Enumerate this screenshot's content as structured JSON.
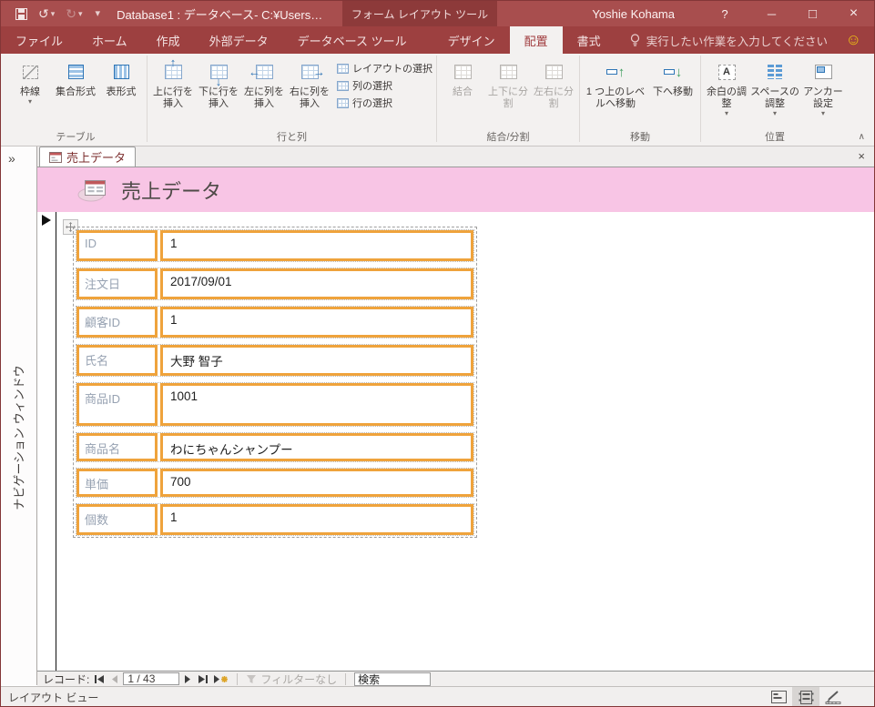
{
  "titlebar": {
    "app_title": "Database1 : データベース- C:¥Users…",
    "contextual_tool": "フォーム レイアウト ツール",
    "user_name": "Yoshie Kohama",
    "help_label": "?",
    "minimize_glyph": "─",
    "maximize_glyph": "□",
    "close_glyph": "×"
  },
  "qat": {
    "undo_glyph": "↺",
    "redo_glyph": "↻",
    "dropdown_glyph": "▾"
  },
  "ribbon_tabs": {
    "file": "ファイル",
    "home": "ホーム",
    "create": "作成",
    "external_data": "外部データ",
    "db_tools": "データベース ツール",
    "design": "デザイン",
    "arrange": "配置",
    "format": "書式",
    "tell_me": "実行したい作業を入力してください",
    "smiley_glyph": "☺"
  },
  "ribbon": {
    "collapse_glyph": "∧",
    "dropdown_glyph": "▾",
    "groups": {
      "table": "テーブル",
      "rows_columns": "行と列",
      "merge_split": "結合/分割",
      "move": "移動",
      "position": "位置"
    },
    "buttons": {
      "gridlines": "枠線",
      "stacked": "集合形式",
      "tabular": "表形式",
      "insert_above": "上に行を挿入",
      "insert_below": "下に行を挿入",
      "insert_left": "左に列を挿入",
      "insert_right": "右に列を挿入",
      "select_layout": "レイアウトの選択",
      "select_column": "列の選択",
      "select_row": "行の選択",
      "merge": "結合",
      "split_vertical": "上下に分割",
      "split_horizontal": "左右に分割",
      "move_up": "1 つ上のレベルへ移動",
      "move_down": "下へ移動",
      "control_margins": "余白の調整",
      "control_padding": "スペースの調整",
      "anchoring": "アンカー設定"
    },
    "arrows": {
      "up": "↑",
      "down": "↓",
      "left": "←",
      "right": "→"
    },
    "margins_icon_letter": "A"
  },
  "nav_pane": {
    "chevron_glyph": "»",
    "title": "ナビゲーション ウィンドウ"
  },
  "document": {
    "tab_label": "売上データ",
    "tab_close_glyph": "×",
    "form_title": "売上データ",
    "fields": [
      {
        "label": "ID",
        "value": "1"
      },
      {
        "label": "注文日",
        "value": "2017/09/01"
      },
      {
        "label": "顧客ID",
        "value": "1"
      },
      {
        "label": "氏名",
        "value": "大野 智子"
      },
      {
        "label": "商品ID",
        "value": "1001"
      },
      {
        "label": "商品名",
        "value": "わにちゃんシャンプー"
      },
      {
        "label": "単価",
        "value": "700"
      },
      {
        "label": "個数",
        "value": "1"
      }
    ]
  },
  "record_nav": {
    "label": "レコード:",
    "position": "1 / 43",
    "filter_label": "フィルターなし",
    "search_value": "検索"
  },
  "status_bar": {
    "view_label": "レイアウト ビュー"
  },
  "colors": {
    "title_red": "#a84e4e",
    "tabrow_red": "#9d4040",
    "contextual_red": "#8d3a3a",
    "header_pink": "#f8c5e5",
    "accent_orange": "#efa33c",
    "accent_blue": "#2e75b6",
    "accent_green": "#3e9e5f",
    "smiley_yellow": "#f2c80f"
  }
}
